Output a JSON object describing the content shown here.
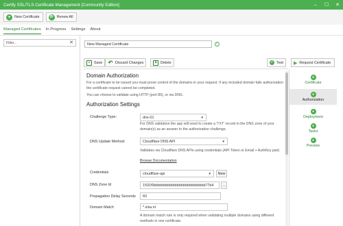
{
  "window": {
    "title": "Certify SSL/TLS Certificate Management [Community Edition]",
    "min": "–",
    "max": "☐",
    "close": "✕"
  },
  "toolbar": {
    "new_certificate": "New Certificate",
    "renew_all": "Renew All"
  },
  "tabs": [
    "Managed Certificates",
    "In Progress",
    "Settings",
    "About"
  ],
  "filter": {
    "placeholder": "Filter...",
    "clear": "✕"
  },
  "cert": {
    "name": "New Managed Certificate"
  },
  "actions": {
    "save": "Save",
    "discard": "Discard Changes",
    "delete": "Delete",
    "test": "Test",
    "request": "Request Certificate"
  },
  "domain_auth": {
    "heading": "Domain Authorization",
    "desc": "For a certificate to be issued you must prove control of the domains in your request. If any included domain fails authorization the certificate request cannot be completed.",
    "validate_note": "You can choose to validate using HTTP (port 80), or via DNS."
  },
  "auth_settings": {
    "heading": "Authorization Settings",
    "challenge_label": "Challenge Type:",
    "challenge_value": "dns-01",
    "challenge_help": "For DNS validation the app will need to create a 'TXT' record in the DNS zone of your domain(s) as an answer to the authorization challenge.",
    "dns_method_label": "DNS Update Method:",
    "dns_method_value": "Cloudflare DNS API",
    "dns_help": "Validates via Cloudflare DNS APIs using credentials (API Token or Email + AuthKey pair)",
    "browse_docs": "Browse Documentation",
    "credentials_label": "Credentials",
    "credentials_value": "cloudflare-api",
    "new_btn": "New",
    "zone_label": "DNS Zone Id",
    "zone_value": "1591f9bbbbbbbbbbbbbbbbbbbbbbbbb77b4",
    "zone_btn": "...",
    "propagation_label": "Propagation Delay Seconds",
    "propagation_value": "60",
    "domain_match_label": "Domain Match",
    "domain_match_value": "*.icka.nl",
    "domain_match_help": "A domain match rule is only required when validating multiple domains using different methods in one certificate."
  },
  "nav": [
    "Certificate",
    "Authorization",
    "Deployment",
    "Tasks",
    "Preview"
  ]
}
